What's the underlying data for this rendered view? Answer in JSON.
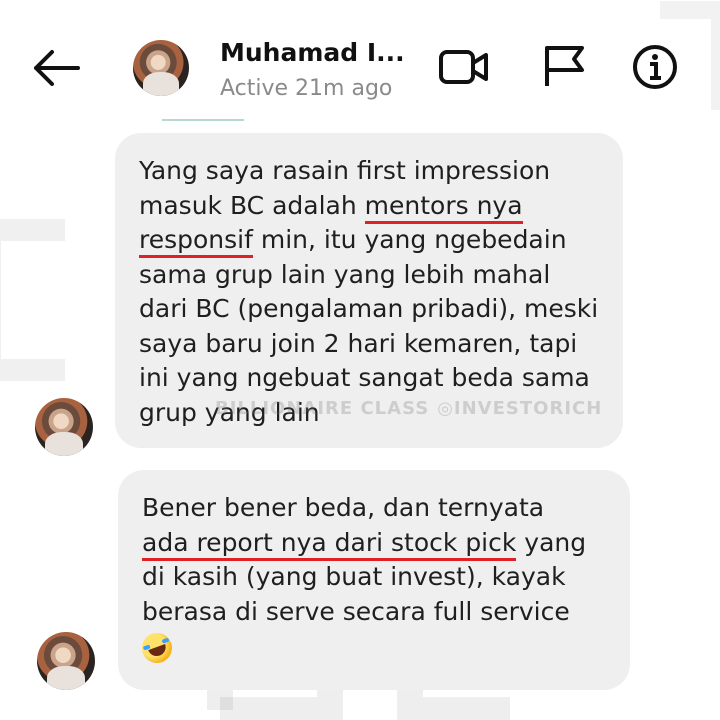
{
  "header": {
    "name": "Muhamad I...",
    "status": "Active 21m ago",
    "icons": [
      "back-arrow-icon",
      "video-call-icon",
      "flag-icon",
      "info-icon"
    ]
  },
  "watermark": {
    "brand": "BILLIONAIRE CLASS",
    "instagram": "INVESTORICH"
  },
  "messages": [
    {
      "lines": [
        [
          {
            "t": "Yang saya rasain first impression"
          }
        ],
        [
          {
            "t": "masuk BC adalah "
          },
          {
            "t": "mentors nya",
            "u": true
          }
        ],
        [
          {
            "t": "responsif",
            "u": true
          },
          {
            "t": " min, itu yang ngebedain"
          }
        ],
        [
          {
            "t": "sama grup lain yang lebih mahal"
          }
        ],
        [
          {
            "t": "dari BC (pengalaman pribadi), meski"
          }
        ],
        [
          {
            "t": "saya baru join 2 hari kemaren, tapi"
          }
        ],
        [
          {
            "t": "ini yang ngebuat sangat beda sama"
          }
        ],
        [
          {
            "t": "grup yang lain"
          }
        ]
      ]
    },
    {
      "lines": [
        [
          {
            "t": "Bener bener beda, dan ternyata"
          }
        ],
        [
          {
            "t": "ada report nya dari stock pick",
            "u": true
          },
          {
            "t": " yang"
          }
        ],
        [
          {
            "t": "di kasih (yang buat invest), kayak"
          }
        ],
        [
          {
            "t": "berasa di serve secara full service"
          }
        ]
      ],
      "emoji": "rolling-on-floor-laughing"
    }
  ],
  "colors": {
    "bubble": "#efefef",
    "underline": "#e01f26",
    "status_text": "#8a8a8a"
  }
}
